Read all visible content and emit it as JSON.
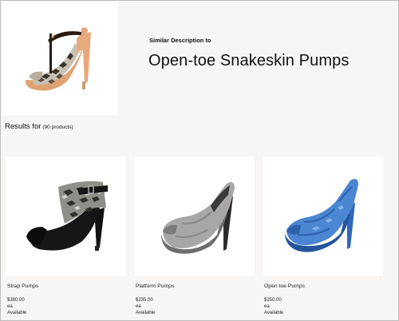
{
  "hero": {
    "image": "tstrap-snakeskin-pump",
    "subtitle": "Similar Description to",
    "title": "Open-toe Snakeskin Pumps"
  },
  "results": {
    "label": "Results for",
    "count": "(90 products)"
  },
  "products": [
    {
      "image": "black-strap-pump",
      "name": "Strap Pumps",
      "price": "$380.00",
      "unit": "ea",
      "availability": "Available"
    },
    {
      "image": "grey-platform-pump",
      "name": "Platform Pumps",
      "price": "$235.00",
      "unit": "ea",
      "availability": "Available"
    },
    {
      "image": "blue-open-toe-pump",
      "name": "Open toe Pumps",
      "price": "$250.00",
      "unit": "ea",
      "availability": "Available"
    }
  ]
}
